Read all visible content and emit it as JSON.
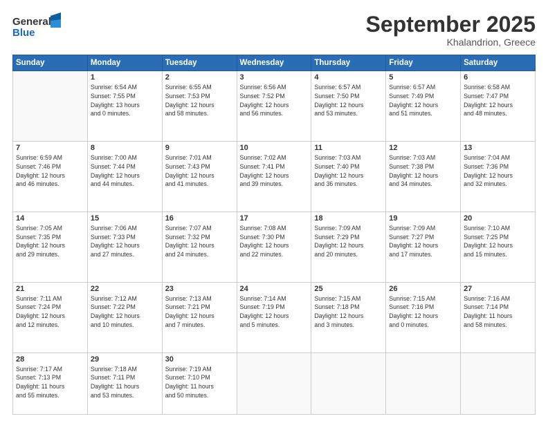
{
  "header": {
    "logo": {
      "line1": "General",
      "line2": "Blue"
    },
    "title": "September 2025",
    "location": "Khalandrion, Greece"
  },
  "weekdays": [
    "Sunday",
    "Monday",
    "Tuesday",
    "Wednesday",
    "Thursday",
    "Friday",
    "Saturday"
  ],
  "weeks": [
    [
      {
        "day": null,
        "info": null
      },
      {
        "day": "1",
        "info": "Sunrise: 6:54 AM\nSunset: 7:55 PM\nDaylight: 13 hours\nand 0 minutes."
      },
      {
        "day": "2",
        "info": "Sunrise: 6:55 AM\nSunset: 7:53 PM\nDaylight: 12 hours\nand 58 minutes."
      },
      {
        "day": "3",
        "info": "Sunrise: 6:56 AM\nSunset: 7:52 PM\nDaylight: 12 hours\nand 56 minutes."
      },
      {
        "day": "4",
        "info": "Sunrise: 6:57 AM\nSunset: 7:50 PM\nDaylight: 12 hours\nand 53 minutes."
      },
      {
        "day": "5",
        "info": "Sunrise: 6:57 AM\nSunset: 7:49 PM\nDaylight: 12 hours\nand 51 minutes."
      },
      {
        "day": "6",
        "info": "Sunrise: 6:58 AM\nSunset: 7:47 PM\nDaylight: 12 hours\nand 48 minutes."
      }
    ],
    [
      {
        "day": "7",
        "info": "Sunrise: 6:59 AM\nSunset: 7:46 PM\nDaylight: 12 hours\nand 46 minutes."
      },
      {
        "day": "8",
        "info": "Sunrise: 7:00 AM\nSunset: 7:44 PM\nDaylight: 12 hours\nand 44 minutes."
      },
      {
        "day": "9",
        "info": "Sunrise: 7:01 AM\nSunset: 7:43 PM\nDaylight: 12 hours\nand 41 minutes."
      },
      {
        "day": "10",
        "info": "Sunrise: 7:02 AM\nSunset: 7:41 PM\nDaylight: 12 hours\nand 39 minutes."
      },
      {
        "day": "11",
        "info": "Sunrise: 7:03 AM\nSunset: 7:40 PM\nDaylight: 12 hours\nand 36 minutes."
      },
      {
        "day": "12",
        "info": "Sunrise: 7:03 AM\nSunset: 7:38 PM\nDaylight: 12 hours\nand 34 minutes."
      },
      {
        "day": "13",
        "info": "Sunrise: 7:04 AM\nSunset: 7:36 PM\nDaylight: 12 hours\nand 32 minutes."
      }
    ],
    [
      {
        "day": "14",
        "info": "Sunrise: 7:05 AM\nSunset: 7:35 PM\nDaylight: 12 hours\nand 29 minutes."
      },
      {
        "day": "15",
        "info": "Sunrise: 7:06 AM\nSunset: 7:33 PM\nDaylight: 12 hours\nand 27 minutes."
      },
      {
        "day": "16",
        "info": "Sunrise: 7:07 AM\nSunset: 7:32 PM\nDaylight: 12 hours\nand 24 minutes."
      },
      {
        "day": "17",
        "info": "Sunrise: 7:08 AM\nSunset: 7:30 PM\nDaylight: 12 hours\nand 22 minutes."
      },
      {
        "day": "18",
        "info": "Sunrise: 7:09 AM\nSunset: 7:29 PM\nDaylight: 12 hours\nand 20 minutes."
      },
      {
        "day": "19",
        "info": "Sunrise: 7:09 AM\nSunset: 7:27 PM\nDaylight: 12 hours\nand 17 minutes."
      },
      {
        "day": "20",
        "info": "Sunrise: 7:10 AM\nSunset: 7:25 PM\nDaylight: 12 hours\nand 15 minutes."
      }
    ],
    [
      {
        "day": "21",
        "info": "Sunrise: 7:11 AM\nSunset: 7:24 PM\nDaylight: 12 hours\nand 12 minutes."
      },
      {
        "day": "22",
        "info": "Sunrise: 7:12 AM\nSunset: 7:22 PM\nDaylight: 12 hours\nand 10 minutes."
      },
      {
        "day": "23",
        "info": "Sunrise: 7:13 AM\nSunset: 7:21 PM\nDaylight: 12 hours\nand 7 minutes."
      },
      {
        "day": "24",
        "info": "Sunrise: 7:14 AM\nSunset: 7:19 PM\nDaylight: 12 hours\nand 5 minutes."
      },
      {
        "day": "25",
        "info": "Sunrise: 7:15 AM\nSunset: 7:18 PM\nDaylight: 12 hours\nand 3 minutes."
      },
      {
        "day": "26",
        "info": "Sunrise: 7:15 AM\nSunset: 7:16 PM\nDaylight: 12 hours\nand 0 minutes."
      },
      {
        "day": "27",
        "info": "Sunrise: 7:16 AM\nSunset: 7:14 PM\nDaylight: 11 hours\nand 58 minutes."
      }
    ],
    [
      {
        "day": "28",
        "info": "Sunrise: 7:17 AM\nSunset: 7:13 PM\nDaylight: 11 hours\nand 55 minutes."
      },
      {
        "day": "29",
        "info": "Sunrise: 7:18 AM\nSunset: 7:11 PM\nDaylight: 11 hours\nand 53 minutes."
      },
      {
        "day": "30",
        "info": "Sunrise: 7:19 AM\nSunset: 7:10 PM\nDaylight: 11 hours\nand 50 minutes."
      },
      {
        "day": null,
        "info": null
      },
      {
        "day": null,
        "info": null
      },
      {
        "day": null,
        "info": null
      },
      {
        "day": null,
        "info": null
      }
    ]
  ]
}
